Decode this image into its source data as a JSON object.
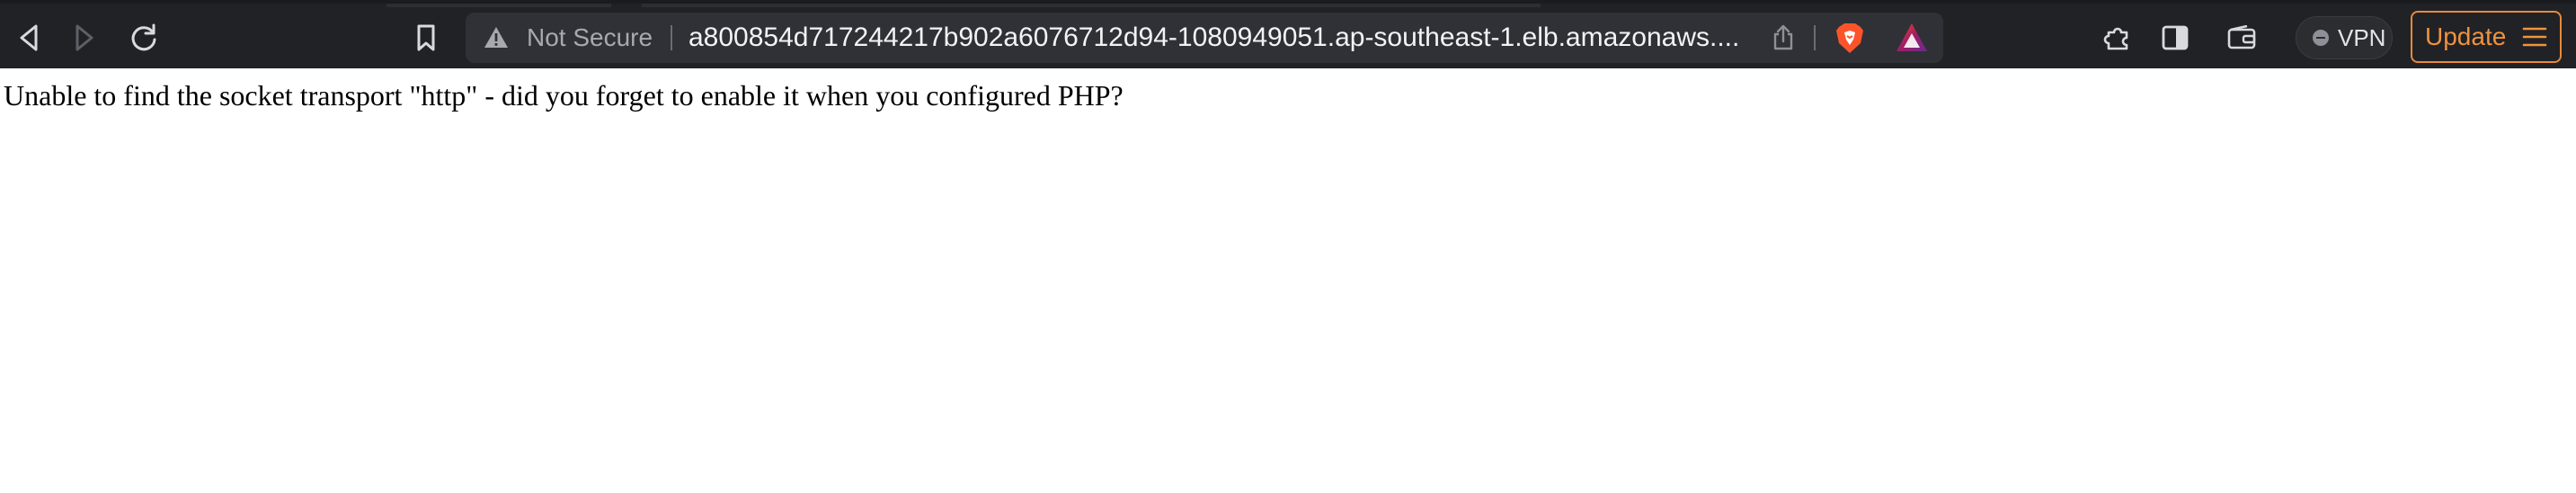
{
  "browser": {
    "address_bar": {
      "security_label": "Not Secure",
      "url": "a800854d717244217b902a6076712d94-1080949051.ap-southeast-1.elb.amazonaws...."
    },
    "vpn_label": "VPN",
    "update_label": "Update",
    "colors": {
      "toolbar_bg": "#202226",
      "address_bg": "#2f3136",
      "update_accent": "#f0923e"
    },
    "icons": [
      "back-icon",
      "forward-icon",
      "reload-icon",
      "bookmark-icon",
      "warning-icon",
      "share-icon",
      "brave-shields-icon",
      "brave-rewards-icon",
      "extensions-icon",
      "sidebar-icon",
      "wallet-icon",
      "menu-icon"
    ]
  },
  "page": {
    "message": "Unable to find the socket transport \"http\" - did you forget to enable it when you configured PHP?"
  }
}
